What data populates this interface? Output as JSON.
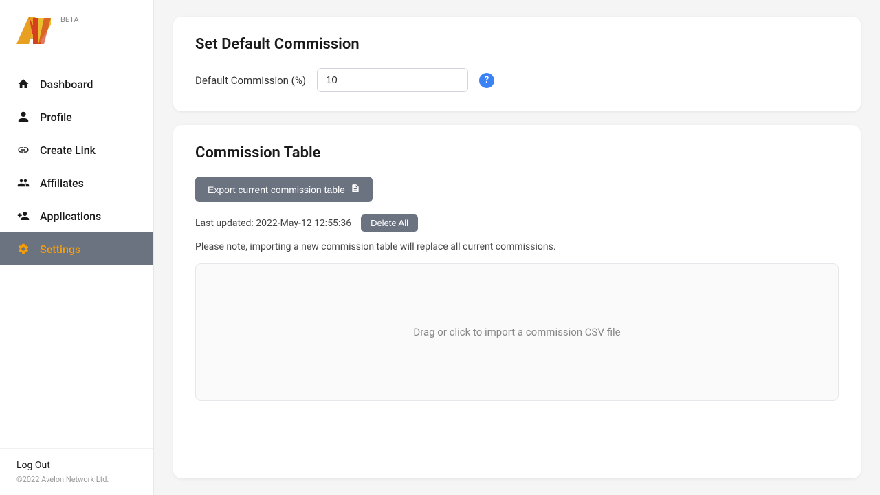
{
  "sidebar": {
    "logo_beta": "BETA",
    "nav_items": [
      {
        "id": "dashboard",
        "label": "Dashboard",
        "icon": "house"
      },
      {
        "id": "profile",
        "label": "Profile",
        "icon": "person"
      },
      {
        "id": "create-link",
        "label": "Create Link",
        "icon": "link"
      },
      {
        "id": "affiliates",
        "label": "Affiliates",
        "icon": "people"
      },
      {
        "id": "applications",
        "label": "Applications",
        "icon": "person-add"
      },
      {
        "id": "settings",
        "label": "Settings",
        "icon": "gear",
        "active": true
      }
    ],
    "logout_label": "Log Out",
    "copyright": "©2022 Avelon Network Ltd."
  },
  "main": {
    "set_default_commission": {
      "title": "Set Default Commission",
      "label": "Default Commission (%)",
      "value": "10",
      "help_icon": "?"
    },
    "commission_table": {
      "title": "Commission Table",
      "export_btn_label": "Export current commission table",
      "export_icon": "📄",
      "last_updated_label": "Last updated: 2022-May-12 12:55:36",
      "delete_all_label": "Delete All",
      "note_text": "Please note, importing a new commission table will replace all current commissions.",
      "drop_zone_text": "Drag or click to import a commission CSV file"
    }
  }
}
